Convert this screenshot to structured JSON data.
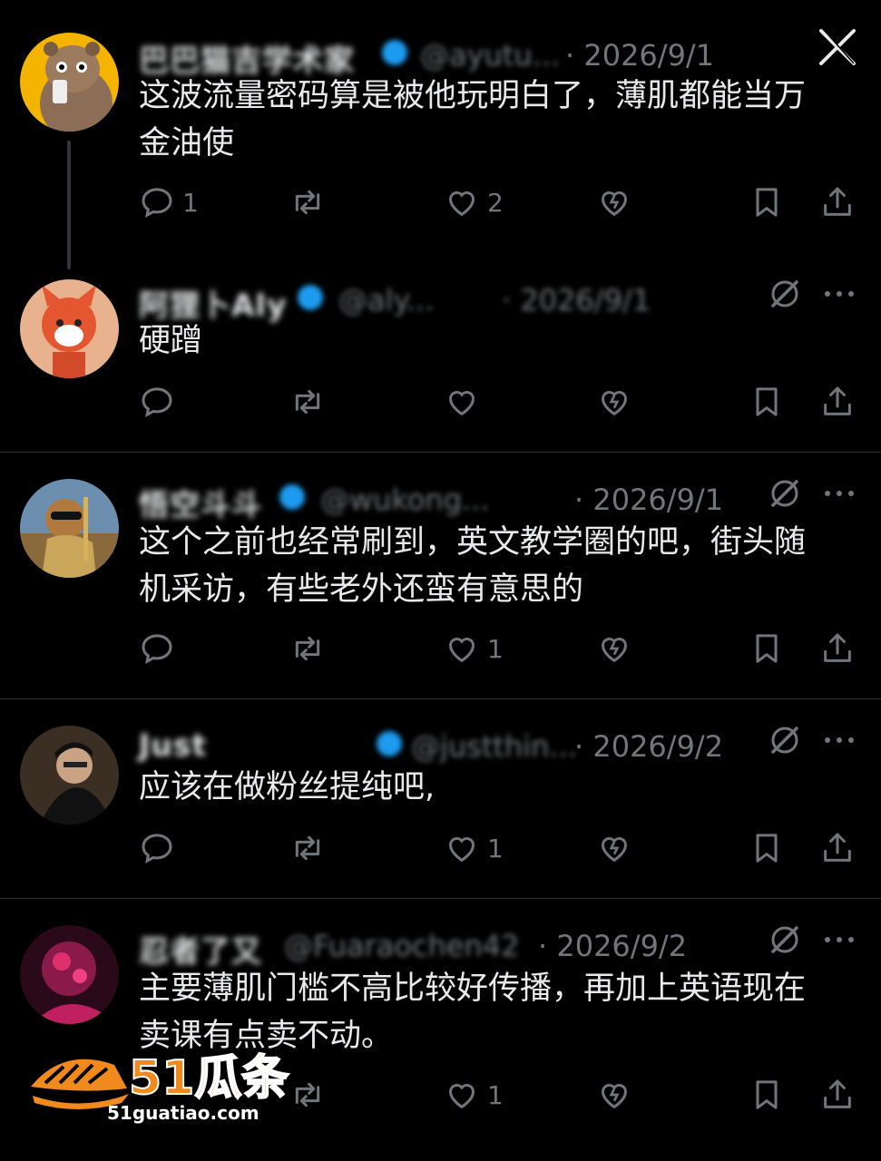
{
  "colors": {
    "background": "#000000",
    "text": "#e7e9ea",
    "muted": "#71767b",
    "verified": "#1d9bf0",
    "divider": "#2f3336",
    "watermark": "#f08a1c"
  },
  "top_bar": {
    "close_icon": "x-logo-icon"
  },
  "posts": [
    {
      "author": "巴巴猫吉学术家",
      "handle": "@ayutu...",
      "date": "· 2026/9/1",
      "text_line1": "这波流量密码算是被他玩明白了，薄肌都能当万",
      "text_line2": "金油使",
      "reply_count": "1",
      "repost_count": "",
      "like_count": "2"
    },
    {
      "author": "阿狸卜Aly",
      "handle": "@aly...",
      "date": "· 2026/9/1",
      "text_line1": "硬蹭",
      "text_line2": "",
      "reply_count": "",
      "repost_count": "",
      "like_count": ""
    },
    {
      "author": "悟空斗斗",
      "handle": "@wukong...",
      "date": "· 2026/9/1",
      "text_line1": "这个之前也经常刷到，英文教学圈的吧，街头随",
      "text_line2": "机采访，有些老外还蛮有意思的",
      "reply_count": "",
      "repost_count": "",
      "like_count": "1"
    },
    {
      "author": "Just",
      "handle": "@justthin...",
      "date": "· 2026/9/2",
      "text_line1": "应该在做粉丝提纯吧,",
      "text_line2": "",
      "reply_count": "",
      "repost_count": "",
      "like_count": "1"
    },
    {
      "author": "忍者了又",
      "handle": "@Fuaraochen42",
      "date": "· 2026/9/2",
      "text_line1": "主要薄肌门槛不高比较好传播，再加上英语现在",
      "text_line2": "卖课有点卖不动。",
      "reply_count": "",
      "repost_count": "",
      "like_count": "1"
    }
  ],
  "watermark": {
    "brand": "51瓜条",
    "url": "51guatiao.com"
  }
}
